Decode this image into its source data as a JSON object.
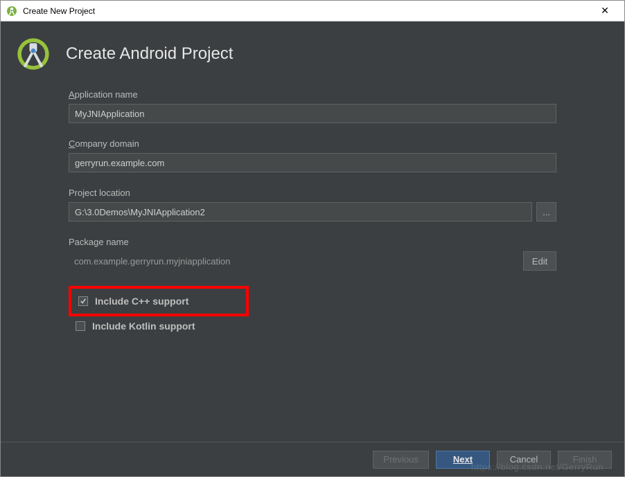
{
  "window": {
    "title": "Create New Project"
  },
  "header": {
    "title": "Create Android Project"
  },
  "fields": {
    "app_name": {
      "label_pre": "A",
      "label_rest": "pplication name",
      "value": "MyJNIApplication"
    },
    "company_domain": {
      "label_pre": "C",
      "label_rest": "ompany domain",
      "value": "gerryrun.example.com"
    },
    "project_location": {
      "label": "Project location",
      "value": "G:\\3.0Demos\\MyJNIApplication2",
      "browse": "..."
    },
    "package_name": {
      "label": "Package name",
      "value": "com.example.gerryrun.myjniapplication",
      "edit": "Edit"
    }
  },
  "checkboxes": {
    "cpp": {
      "label": "Include C++ support",
      "checked": true
    },
    "kotlin": {
      "label": "Include Kotlin support",
      "checked": false
    }
  },
  "footer": {
    "previous": "Previous",
    "next": "Next",
    "cancel": "Cancel",
    "finish": "Finish"
  },
  "watermark": "https://blog.csdn.net/GerryRun"
}
